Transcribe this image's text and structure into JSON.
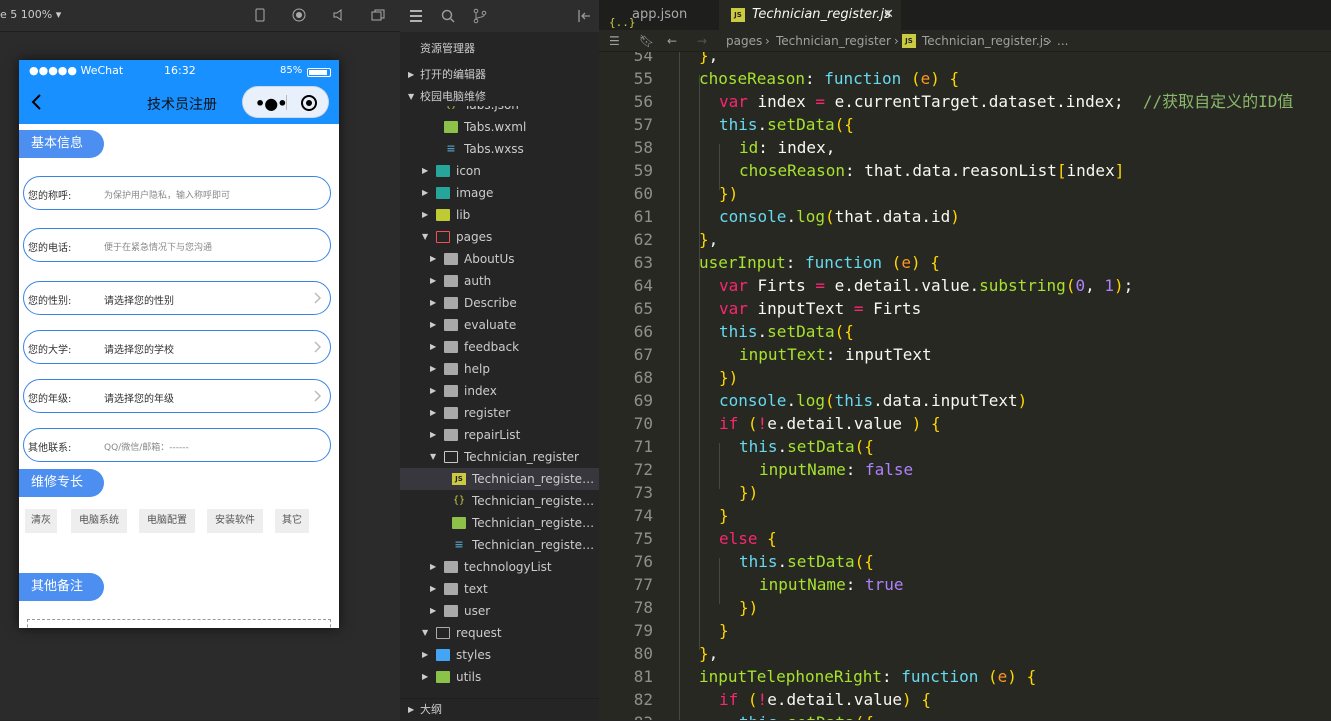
{
  "simulator": {
    "device_label": "e 5 100% ▾",
    "status": {
      "carrier": "●●●●● WeChat",
      "time": "16:32",
      "battery": "85%"
    },
    "nav_title": "技术员注册",
    "sections": {
      "basic": "基本信息",
      "skills": "维修专长",
      "remark": "其他备注"
    },
    "fields": [
      {
        "label": "您的称呼:",
        "placeholder": "为保护用户隐私，输入称呼即可"
      },
      {
        "label": "您的电话:",
        "placeholder": "便于在紧急情况下与您沟通"
      },
      {
        "label": "您的性别:",
        "placeholder": "请选择您的性别"
      },
      {
        "label": "您的大学:",
        "placeholder": "请选择您的学校"
      },
      {
        "label": "您的年级:",
        "placeholder": "请选择您的年级"
      },
      {
        "label": "其他联系:",
        "placeholder": "QQ/微信/邮箱：------"
      }
    ],
    "skills": [
      "清灰",
      "电脑系统",
      "电脑配置",
      "安装软件",
      "其它"
    ]
  },
  "explorer": {
    "title": "资源管理器",
    "open_editors": "打开的编辑器",
    "project": "校园电脑维修",
    "outline": "大纲",
    "tree": [
      {
        "name": "Tabs.json",
        "type": "json",
        "depth": 2
      },
      {
        "name": "Tabs.wxml",
        "type": "wxml",
        "depth": 2
      },
      {
        "name": "Tabs.wxss",
        "type": "wxss",
        "depth": 2
      },
      {
        "name": "icon",
        "type": "folder",
        "depth": 1
      },
      {
        "name": "image",
        "type": "folder",
        "depth": 1
      },
      {
        "name": "lib",
        "type": "folder",
        "depth": 1
      },
      {
        "name": "pages",
        "type": "folder-open",
        "depth": 1
      },
      {
        "name": "AboutUs",
        "type": "folder",
        "depth": 2
      },
      {
        "name": "auth",
        "type": "folder",
        "depth": 2
      },
      {
        "name": "Describe",
        "type": "folder",
        "depth": 2
      },
      {
        "name": "evaluate",
        "type": "folder",
        "depth": 2
      },
      {
        "name": "feedback",
        "type": "folder",
        "depth": 2
      },
      {
        "name": "help",
        "type": "folder",
        "depth": 2
      },
      {
        "name": "index",
        "type": "folder",
        "depth": 2
      },
      {
        "name": "register",
        "type": "folder",
        "depth": 2
      },
      {
        "name": "repairList",
        "type": "folder",
        "depth": 2
      },
      {
        "name": "Technician_register",
        "type": "folder-open",
        "depth": 2
      },
      {
        "name": "Technician_register.js",
        "type": "js",
        "depth": 3,
        "selected": true
      },
      {
        "name": "Technician_register.json",
        "type": "json",
        "depth": 3
      },
      {
        "name": "Technician_register.wxml",
        "type": "wxml",
        "depth": 3
      },
      {
        "name": "Technician_register.wxss",
        "type": "wxss",
        "depth": 3
      },
      {
        "name": "technologyList",
        "type": "folder",
        "depth": 2
      },
      {
        "name": "text",
        "type": "folder",
        "depth": 2
      },
      {
        "name": "user",
        "type": "folder",
        "depth": 2
      },
      {
        "name": "request",
        "type": "folder-open",
        "depth": 1
      },
      {
        "name": "styles",
        "type": "folder",
        "depth": 1
      },
      {
        "name": "utils",
        "type": "folder",
        "depth": 1
      }
    ]
  },
  "editor": {
    "tabs": [
      {
        "label": "app.json",
        "icon": "{..}"
      },
      {
        "label": "Technician_register.js",
        "icon": "JS",
        "active": true
      }
    ],
    "breadcrumb": [
      "pages",
      "›",
      "Technician_register",
      "›",
      "Technician_register.js",
      "›",
      "..."
    ],
    "first_line": 54,
    "lines": [
      "},",
      "choseReason: function (e) {",
      "var index = e.currentTarget.dataset.index;  //获取自定义的ID值",
      "this.setData({",
      "id: index,",
      "choseReason: that.data.reasonList[index]",
      "})",
      "console.log(that.data.id)",
      "},",
      "userInput: function (e) {",
      "var Firts = e.detail.value.substring(0, 1);",
      "var inputText = Firts",
      "this.setData({",
      "inputText: inputText",
      "})",
      "console.log(this.data.inputText)",
      "if (!e.detail.value ) {",
      "this.setData({",
      "inputName: false",
      "})",
      "}",
      "else {",
      "this.setData({",
      "inputName: true",
      "})",
      "}",
      "},",
      "inputTelephoneRight: function (e) {",
      "if (!e.detail.value) {",
      "this.setData({"
    ]
  }
}
